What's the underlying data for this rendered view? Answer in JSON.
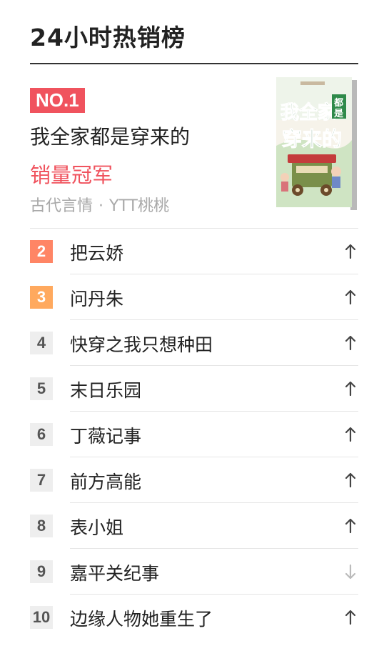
{
  "header": {
    "title": "24小时热销榜"
  },
  "top_item": {
    "badge": "NO.1",
    "title": "我全家都是穿来的",
    "tag": "销量冠军",
    "category": "古代言情",
    "separator": "·",
    "author": "YTT桃桃",
    "cover": {
      "title_line1": "我全家",
      "title_line2": "穿来的",
      "side_char1": "都",
      "side_char2": "是"
    }
  },
  "colors": {
    "accent": "#f0535e",
    "rank2": "#ff8565",
    "rank3": "#ffa95e",
    "trend_up": "#444444",
    "trend_down": "#bbbbbb"
  },
  "list": [
    {
      "rank": "2",
      "name": "把云娇",
      "trend": "up"
    },
    {
      "rank": "3",
      "name": "问丹朱",
      "trend": "up"
    },
    {
      "rank": "4",
      "name": "快穿之我只想种田",
      "trend": "up"
    },
    {
      "rank": "5",
      "name": "末日乐园",
      "trend": "up"
    },
    {
      "rank": "6",
      "name": "丁薇记事",
      "trend": "up"
    },
    {
      "rank": "7",
      "name": "前方高能",
      "trend": "up"
    },
    {
      "rank": "8",
      "name": "表小姐",
      "trend": "up"
    },
    {
      "rank": "9",
      "name": "嘉平关纪事",
      "trend": "down"
    },
    {
      "rank": "10",
      "name": "边缘人物她重生了",
      "trend": "up"
    }
  ]
}
